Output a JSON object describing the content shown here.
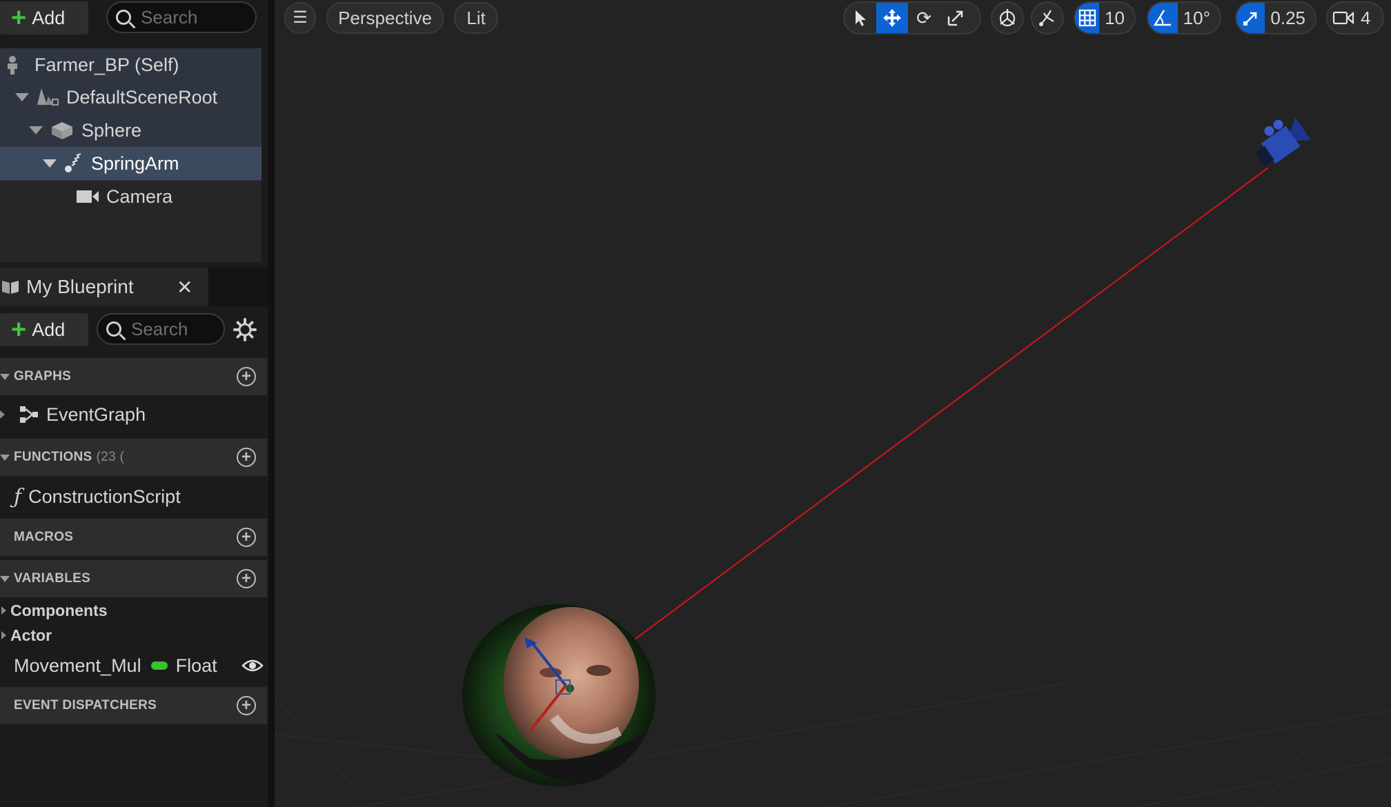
{
  "components_panel": {
    "add_label": "Add",
    "search_placeholder": "Search",
    "tree": [
      {
        "label": "Farmer_BP (Self)",
        "icon": "actor-icon"
      },
      {
        "label": "DefaultSceneRoot",
        "icon": "scene-root-icon"
      },
      {
        "label": "Sphere",
        "icon": "static-mesh-icon"
      },
      {
        "label": "SpringArm",
        "icon": "spring-arm-icon",
        "selected": true
      },
      {
        "label": "Camera",
        "icon": "camera-icon"
      }
    ]
  },
  "my_blueprint": {
    "tab_title": "My Blueprint",
    "add_label": "Add",
    "search_placeholder": "Search",
    "sections": {
      "graphs": "GRAPHS",
      "functions": "FUNCTIONS",
      "functions_count": "(23 (",
      "macros": "MACROS",
      "variables": "VARIABLES",
      "event_dispatchers": "EVENT DISPATCHERS"
    },
    "graph_item": "EventGraph",
    "function_item": "ConstructionScript",
    "variable_categories": [
      "Components",
      "Actor"
    ],
    "variable": {
      "name": "Movement_Mul",
      "type": "Float",
      "type_color": "#39c22b"
    }
  },
  "viewport_toolbar": {
    "view_mode": "Perspective",
    "lighting": "Lit",
    "grid_snap": "10",
    "rotation_snap": "10°",
    "scale_snap": "0.25",
    "camera_speed": "4",
    "accent_color": "#0e63d3"
  },
  "viewport": {
    "spring_arm_line_color": "#c8141e",
    "camera_gizmo_color": "#2b4bb5"
  }
}
